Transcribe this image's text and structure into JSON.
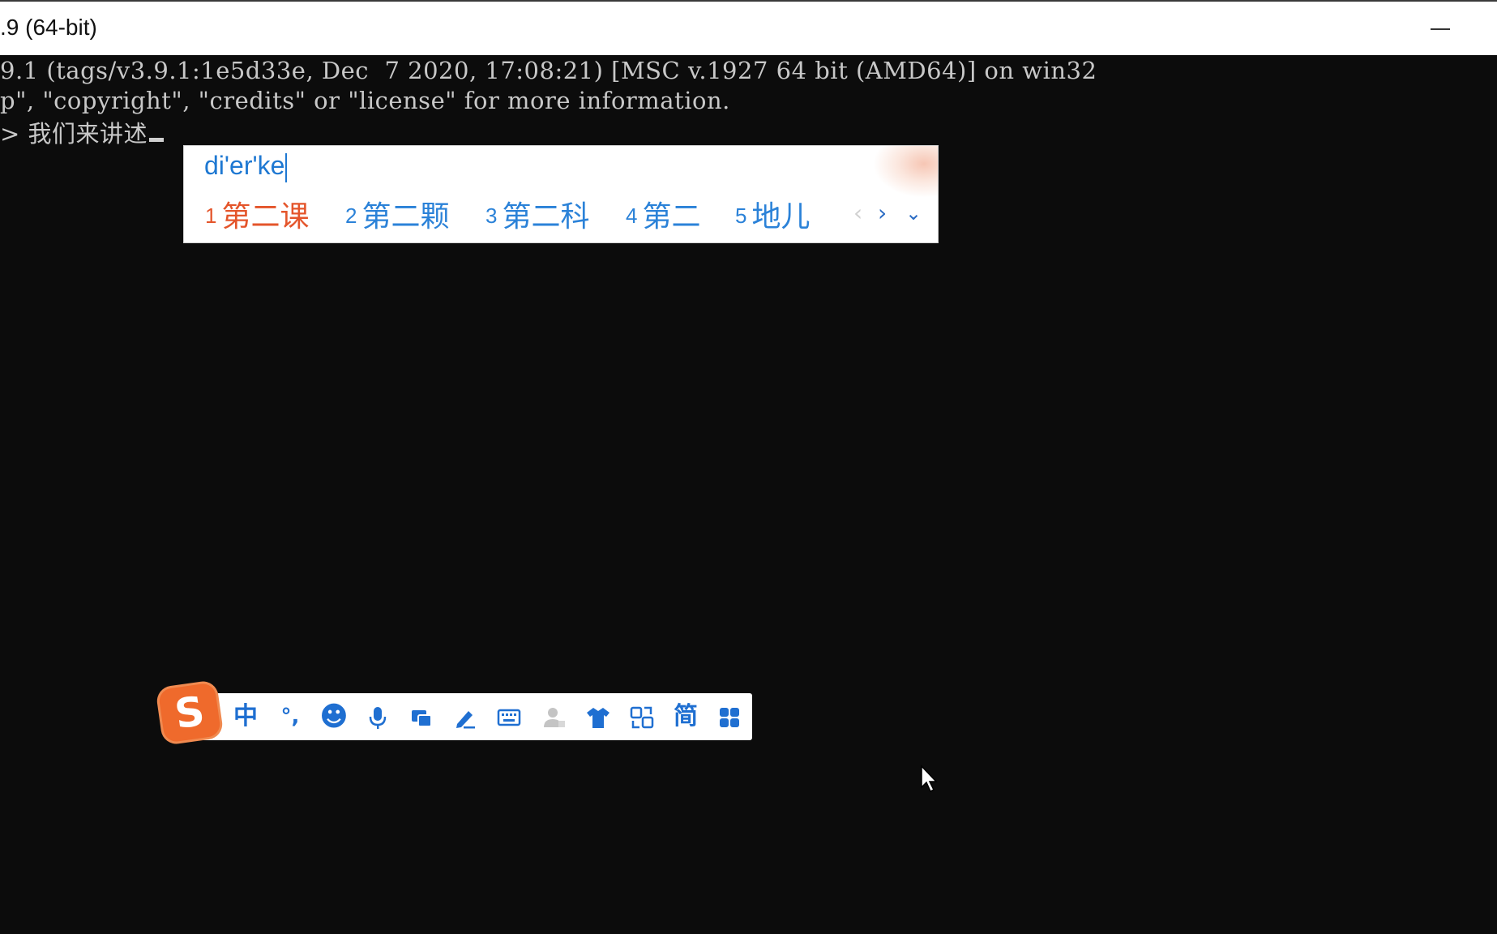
{
  "window": {
    "title": ".9 (64-bit)"
  },
  "console": {
    "line1": "9.1 (tags/v3.9.1:1e5d33e, Dec  7 2020, 17:08:21) [MSC v.1927 64 bit (AMD64)] on win32",
    "line2": "p\", \"copyright\", \"credits\" or \"license\" for more information.",
    "line3": "> 我们来讲述"
  },
  "ime": {
    "composition": "di'er'ke",
    "candidates": [
      {
        "num": "1",
        "text": "第二课"
      },
      {
        "num": "2",
        "text": "第二颗"
      },
      {
        "num": "3",
        "text": "第二科"
      },
      {
        "num": "4",
        "text": "第二"
      },
      {
        "num": "5",
        "text": "地儿"
      }
    ],
    "nav": {
      "prev": "‹",
      "next": "›",
      "more": "⌄"
    },
    "colors": {
      "selected": "#e4552b",
      "normal": "#2b82d8",
      "composition": "#1e78d2"
    }
  },
  "toolbar": {
    "logo": "S",
    "chinese_mode": "中",
    "punctuation": "°,",
    "emoji": "☻",
    "simplified": "简",
    "icon_color": "#1f6fd1",
    "logo_color": "#ef6a2c"
  }
}
